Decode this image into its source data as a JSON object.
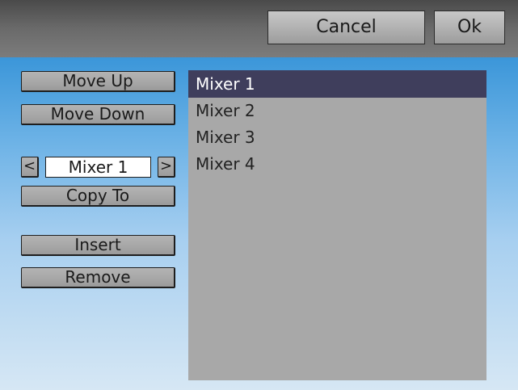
{
  "header": {
    "cancel_label": "Cancel",
    "ok_label": "Ok"
  },
  "sidebar": {
    "move_up_label": "Move Up",
    "move_down_label": "Move Down",
    "selector": {
      "prev_label": "<",
      "value": "Mixer 1",
      "next_label": ">"
    },
    "copy_to_label": "Copy To",
    "insert_label": "Insert",
    "remove_label": "Remove"
  },
  "list": {
    "items": [
      {
        "label": "Mixer 1",
        "selected": true
      },
      {
        "label": "Mixer 2",
        "selected": false
      },
      {
        "label": "Mixer 3",
        "selected": false
      },
      {
        "label": "Mixer 4",
        "selected": false
      }
    ]
  },
  "colors": {
    "selected_row": "#3f3e5c",
    "list_background": "#a8a8a8",
    "top_bar": "#5a5a5a",
    "accent_blue": "#3b96d9"
  }
}
